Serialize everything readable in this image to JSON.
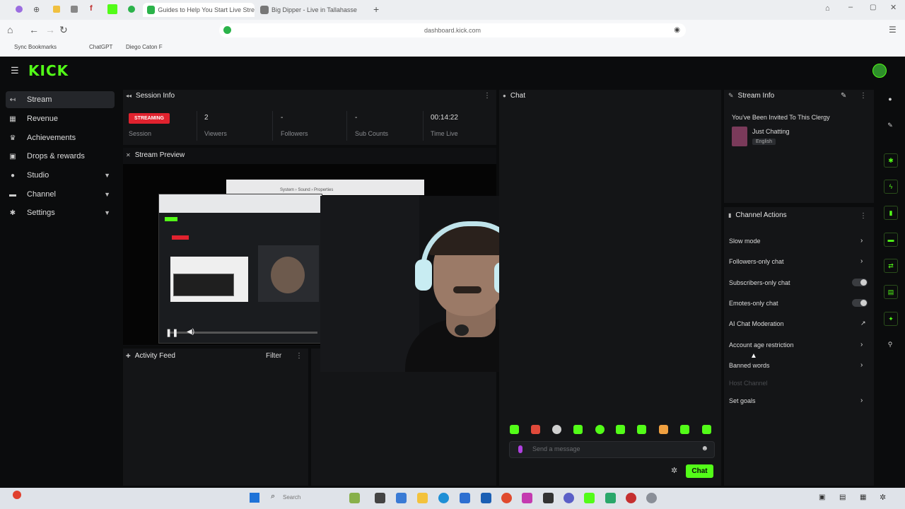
{
  "browser": {
    "tabs": [
      {
        "label": "Guides to Help You Start Live Stre",
        "active": true
      },
      {
        "label": "Big Dipper - Live in Tallahasse",
        "active": false
      }
    ],
    "new_tab": "+",
    "url": "dashboard.kick.com",
    "bookmarks": [
      "Sync Bookmarks",
      "ChatGPT",
      "Diego Caton F"
    ]
  },
  "app": {
    "logo": "KICK",
    "nav": [
      {
        "label": "Stream",
        "icon": "stream-icon",
        "active": true
      },
      {
        "label": "Revenue",
        "icon": "revenue-icon"
      },
      {
        "label": "Achievements",
        "icon": "trophy-icon"
      },
      {
        "label": "Drops & rewards",
        "icon": "gift-icon"
      },
      {
        "label": "Studio",
        "icon": "studio-icon",
        "expandable": true
      },
      {
        "label": "Channel",
        "icon": "channel-icon",
        "expandable": true
      },
      {
        "label": "Settings",
        "icon": "gear-icon",
        "expandable": true
      }
    ]
  },
  "session_info": {
    "title": "Session Info",
    "status_badge": "STREAMING",
    "stats": [
      {
        "value": "",
        "label": "Session"
      },
      {
        "value": "2",
        "label": "Viewers"
      },
      {
        "value": "-",
        "label": "Followers"
      },
      {
        "value": "-",
        "label": "Sub Counts"
      },
      {
        "value": "00:14:22",
        "label": "Time Live"
      }
    ]
  },
  "stream_preview": {
    "title": "Stream Preview",
    "inner_breadcrumb": "System › Sound › Properties"
  },
  "activity_feed": {
    "title": "Activity Feed",
    "filter_label": "Filter"
  },
  "chat": {
    "title": "Chat",
    "placeholder": "Send a message",
    "send_label": "Chat",
    "emote_colors": [
      "#53fc18",
      "#e04a3a",
      "#cfcfcf",
      "#53fc18",
      "#53fc18",
      "#53fc18",
      "#53fc18",
      "#f0a040",
      "#53fc18",
      "#53fc18"
    ]
  },
  "stream_info": {
    "title": "Stream Info",
    "stream_title": "You've Been Invited To This Clergy",
    "category": "Just Chatting",
    "language": "English"
  },
  "channel_actions": {
    "title": "Channel Actions",
    "items": [
      {
        "label": "Slow mode",
        "control": "chevron"
      },
      {
        "label": "Followers-only chat",
        "control": "chevron"
      },
      {
        "label": "Subscribers-only chat",
        "control": "toggle"
      },
      {
        "label": "Emotes-only chat",
        "control": "toggle"
      },
      {
        "label": "AI Chat Moderation",
        "control": "external"
      },
      {
        "label": "Account age restriction",
        "control": "chevron"
      },
      {
        "label": "Banned words",
        "control": "chevron"
      },
      {
        "label": "Host Channel",
        "control": "none",
        "disabled": true
      },
      {
        "label": "Set goals",
        "control": "chevron"
      }
    ]
  },
  "taskbar": {
    "search_placeholder": "Search"
  },
  "colors": {
    "accent": "#53fc18",
    "live": "#e0222e",
    "panel": "#141517",
    "background": "#0b0c0d"
  }
}
